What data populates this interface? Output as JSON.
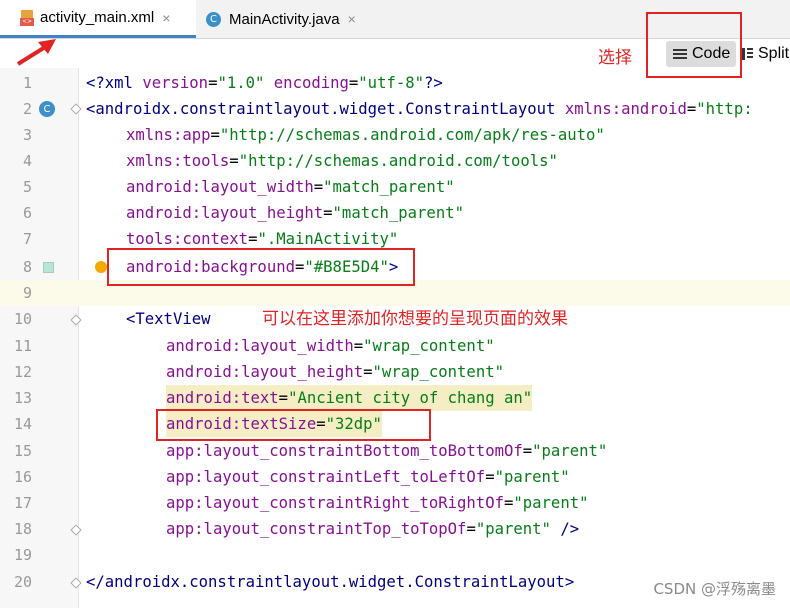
{
  "tabs": [
    {
      "label": "activity_main.xml",
      "active": true,
      "icon": "xml-file-icon",
      "close": "×"
    },
    {
      "label": "MainActivity.java",
      "active": false,
      "icon": "java-class-icon",
      "icon_letter": "C",
      "close": "×"
    }
  ],
  "annotations": {
    "select_label": "选择",
    "add_effect_label": "可以在这里添加你想要的呈现页面的效果"
  },
  "view_modes": {
    "code_label": "Code",
    "split_label": "Split"
  },
  "editor": {
    "line_numbers": [
      "1",
      "2",
      "3",
      "4",
      "5",
      "6",
      "7",
      "8",
      "9",
      "10",
      "11",
      "12",
      "13",
      "14",
      "15",
      "16",
      "17",
      "18",
      "19",
      "20"
    ],
    "gutter_class_letter": "C",
    "color_swatch": "#B8E5D4",
    "lines": {
      "l1": {
        "a": "<?xml ",
        "b": "version",
        "c": "=",
        "d": "\"1.0\"",
        "e": " ",
        "f": "encoding",
        "g": "=",
        "h": "\"utf-8\"",
        "i": "?>"
      },
      "l2": {
        "a": "<androidx.constraintlayout.widget.ConstraintLayout ",
        "b": "xmlns:",
        "c": "android",
        "d": "=",
        "e": "\"http:"
      },
      "l3": {
        "a": "xmlns:",
        "b": "app",
        "c": "=",
        "d": "\"http://schemas.android.com/apk/res-auto\""
      },
      "l4": {
        "a": "xmlns:",
        "b": "tools",
        "c": "=",
        "d": "\"http://schemas.android.com/tools\""
      },
      "l5": {
        "a": "android:layout_width",
        "b": "=",
        "c": "\"match_parent\""
      },
      "l6": {
        "a": "android:layout_height",
        "b": "=",
        "c": "\"match_parent\""
      },
      "l7": {
        "a": "tools:context",
        "b": "=",
        "c": "\".MainActivity\""
      },
      "l8": {
        "a": "android:background",
        "b": "=",
        "c": "\"#B8E5D4\"",
        "d": ">"
      },
      "l10": {
        "a": "<TextView"
      },
      "l11": {
        "a": "android:layout_width",
        "b": "=",
        "c": "\"wrap_content\""
      },
      "l12": {
        "a": "android:layout_height",
        "b": "=",
        "c": "\"wrap_content\""
      },
      "l13": {
        "a": "android:text",
        "b": "=",
        "c": "\"Ancient city of chang an\""
      },
      "l14": {
        "a": "android:textSize",
        "b": "=",
        "c": "\"32dp\""
      },
      "l15": {
        "a": "app:layout_constraintBottom_toBottomOf",
        "b": "=",
        "c": "\"parent\""
      },
      "l16": {
        "a": "app:layout_constraintLeft_toLeftOf",
        "b": "=",
        "c": "\"parent\""
      },
      "l17": {
        "a": "app:layout_constraintRight_toRightOf",
        "b": "=",
        "c": "\"parent\""
      },
      "l18": {
        "a": "app:layout_constraintTop_toTopOf",
        "b": "=",
        "c": "\"parent\"",
        "d": " />"
      },
      "l20": {
        "a": "</androidx.constraintlayout.widget.ConstraintLayout",
        "b": ">"
      }
    }
  },
  "watermark": "CSDN @浮殇离墨",
  "colors": {
    "annotation_red": "#E02424",
    "tab_underline": "#4083C9",
    "attribute": "#871094",
    "value": "#067D17",
    "tag": "#000080"
  }
}
